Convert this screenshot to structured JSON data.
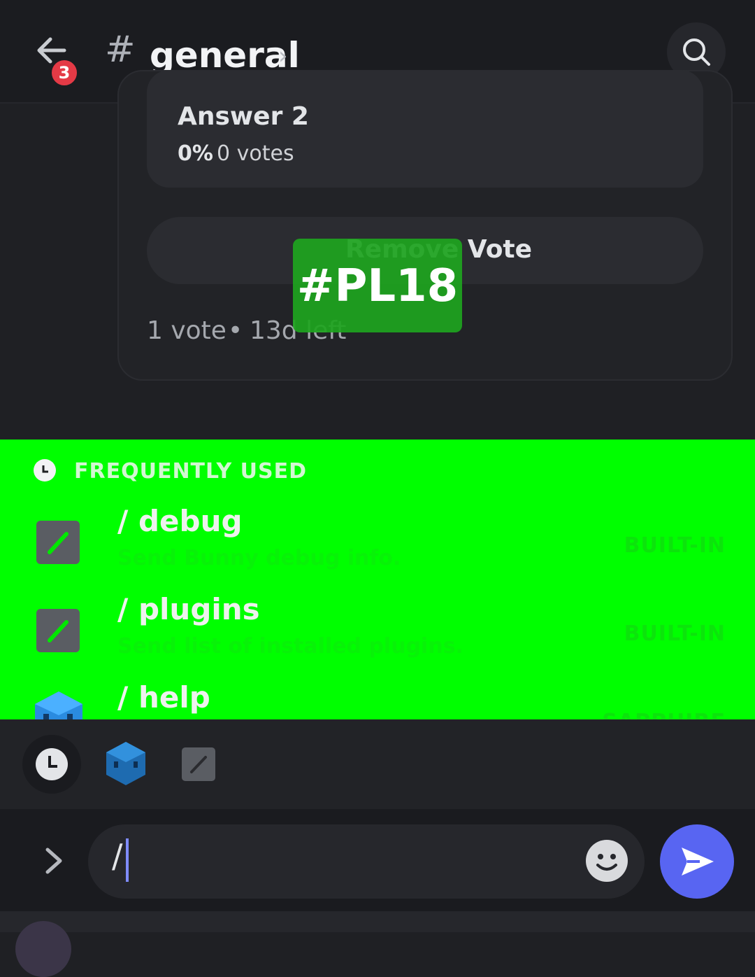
{
  "header": {
    "back_badge": "3",
    "hash_symbol": "#",
    "channel_name": "general",
    "chevron": "›",
    "icons": {
      "back": "back-arrow-icon",
      "search": "search-icon"
    }
  },
  "poll": {
    "answer_label": "Answer 2",
    "answer_percent": "0%",
    "answer_votes": "0 votes",
    "remove_vote_label": "Remove Vote",
    "vote_count": "1 vote",
    "separator": "•",
    "time_left": "13d left"
  },
  "overlay_tag": "#PL18",
  "suggestions": {
    "section_label": "FREQUENTLY USED",
    "commands": [
      {
        "name": "/ debug",
        "description": "Send Bunny debug info.",
        "source": "BUILT-IN"
      },
      {
        "name": "/ plugins",
        "description": "Send list of installed plugins.",
        "source": "BUILT-IN"
      },
      {
        "name": "/ help",
        "description": "",
        "source": "SAPPHIRE"
      }
    ]
  },
  "category_bar": {
    "items": [
      "recent-clock-icon",
      "bunny-app-icon",
      "slash-command-icon"
    ]
  },
  "composer": {
    "input_value": "/",
    "icons": {
      "expand": "chevron-right-icon",
      "emoji": "emoji-face-icon",
      "send": "send-arrow-icon"
    }
  },
  "colors": {
    "background": "#1f2024",
    "panel_highlight": "#00ff00",
    "tag_green": "#1ea41f",
    "accent": "#5865f2",
    "badge_red": "#e43a46"
  }
}
